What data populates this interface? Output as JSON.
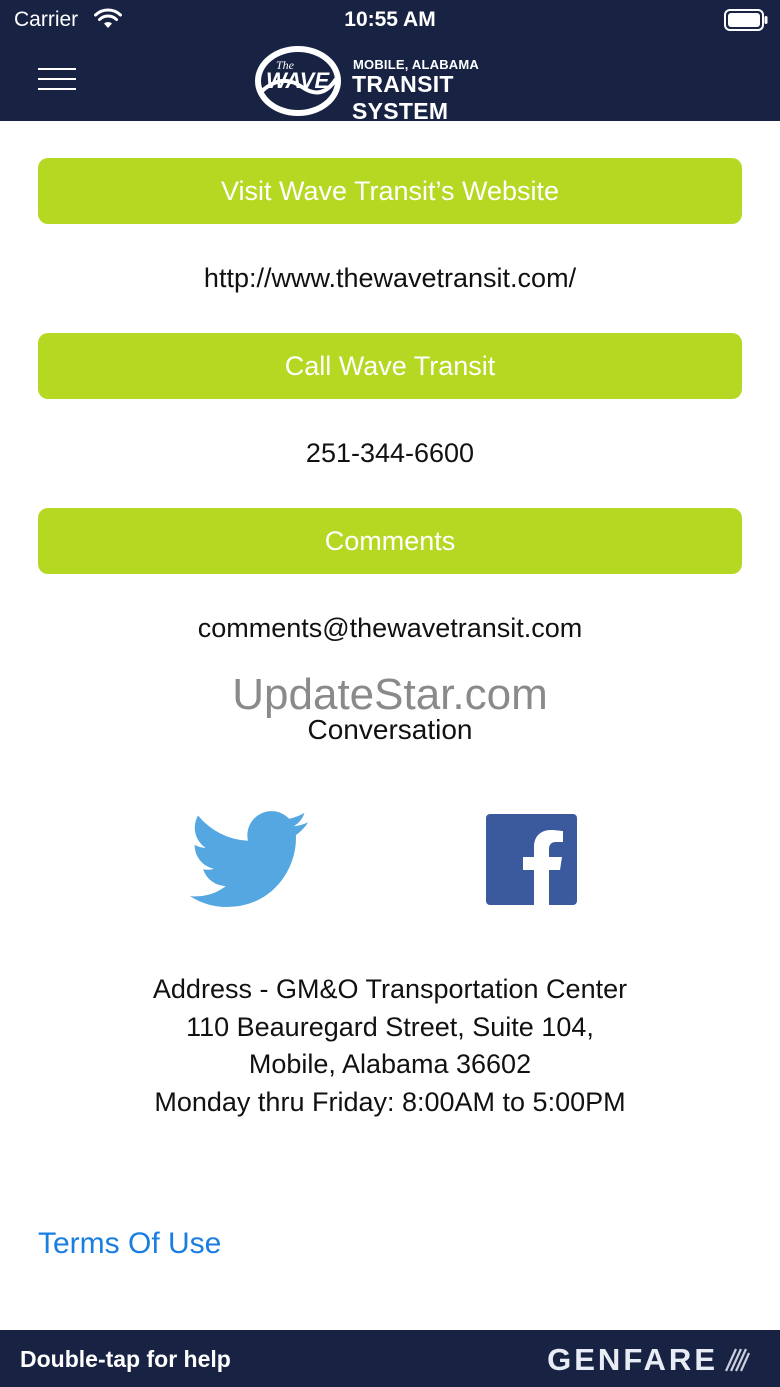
{
  "status_bar": {
    "carrier": "Carrier",
    "time": "10:55 AM",
    "wifi_icon": "wifi-icon",
    "battery_icon": "battery-icon"
  },
  "header": {
    "menu_icon": "hamburger-menu-icon",
    "logo_badge_top": "The",
    "logo_badge_main": "WAVE",
    "logo_subtitle": "MOBILE, ALABAMA",
    "logo_title": "TRANSIT SYSTEM",
    "background_color": "#182344"
  },
  "main": {
    "accent_color": "#b5d823",
    "website_button_label": "Visit Wave Transit’s Website",
    "website_url": "http://www.thewavetransit.com/",
    "call_button_label": "Call Wave Transit",
    "phone_number": "251-344-6600",
    "comments_button_label": "Comments",
    "comments_email": "comments@thewavetransit.com",
    "watermark": "UpdateStar.com",
    "conversation_heading": "Conversation",
    "social": {
      "twitter_icon": "twitter-icon",
      "facebook_icon": "facebook-icon"
    },
    "address_lines": [
      "Address - GM&O Transportation Center",
      "110 Beauregard Street, Suite 104,",
      "Mobile, Alabama 36602",
      "Monday thru Friday: 8:00AM to 5:00PM"
    ],
    "terms_link": "Terms Of Use",
    "link_color": "#1a7ee0"
  },
  "footer": {
    "help_text": "Double-tap for help",
    "brand": "GENFARE"
  }
}
